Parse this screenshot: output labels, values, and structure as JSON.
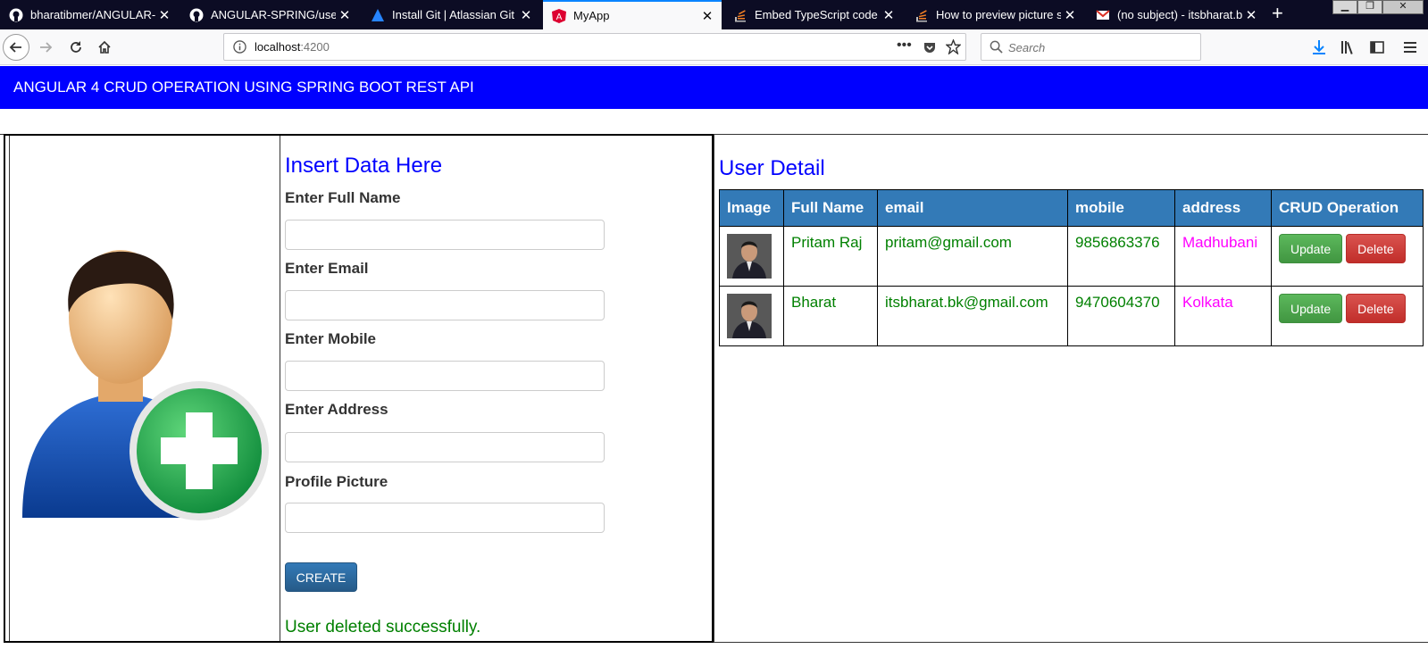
{
  "browser": {
    "tabs": [
      {
        "label": "bharatibmer/ANGULAR-SP",
        "icon": "github-icon"
      },
      {
        "label": "ANGULAR-SPRING/userCR",
        "icon": "github-icon"
      },
      {
        "label": "Install Git | Atlassian Git Tut",
        "icon": "atlassian-icon"
      },
      {
        "label": "MyApp",
        "icon": "angular-icon"
      },
      {
        "label": "Embed TypeScript code in",
        "icon": "stackoverflow-icon"
      },
      {
        "label": "How to preview picture sto",
        "icon": "stackoverflow-icon"
      },
      {
        "label": "(no subject) - itsbharat.bk@",
        "icon": "gmail-icon"
      }
    ],
    "url_host": "localhost",
    "url_port": ":4200",
    "search_placeholder": "Search"
  },
  "app": {
    "header_title": "ANGULAR 4 CRUD OPERATION USING SPRING BOOT REST API",
    "form": {
      "title": "Insert Data Here",
      "fields": [
        {
          "label": "Enter Full Name",
          "value": ""
        },
        {
          "label": "Enter Email",
          "value": ""
        },
        {
          "label": "Enter Mobile",
          "value": ""
        },
        {
          "label": "Enter Address",
          "value": ""
        },
        {
          "label": "Profile Picture",
          "value": ""
        }
      ],
      "create_label": "CREATE",
      "status_message": "User deleted successfully."
    },
    "detail": {
      "title": "User Detail",
      "columns": [
        "Image",
        "Full Name",
        "email",
        "mobile",
        "address",
        "CRUD Operation"
      ],
      "rows": [
        {
          "name": "Pritam Raj",
          "email": "pritam@gmail.com",
          "mobile": "9856863376",
          "address": "Madhubani"
        },
        {
          "name": "Bharat",
          "email": "itsbharat.bk@gmail.com",
          "mobile": "9470604370",
          "address": "Kolkata"
        }
      ],
      "update_label": "Update",
      "delete_label": "Delete"
    },
    "colors": {
      "header": "#0000ff",
      "table_head": "#337ab7",
      "text_green": "#008000",
      "address": "#ff00ff"
    }
  }
}
